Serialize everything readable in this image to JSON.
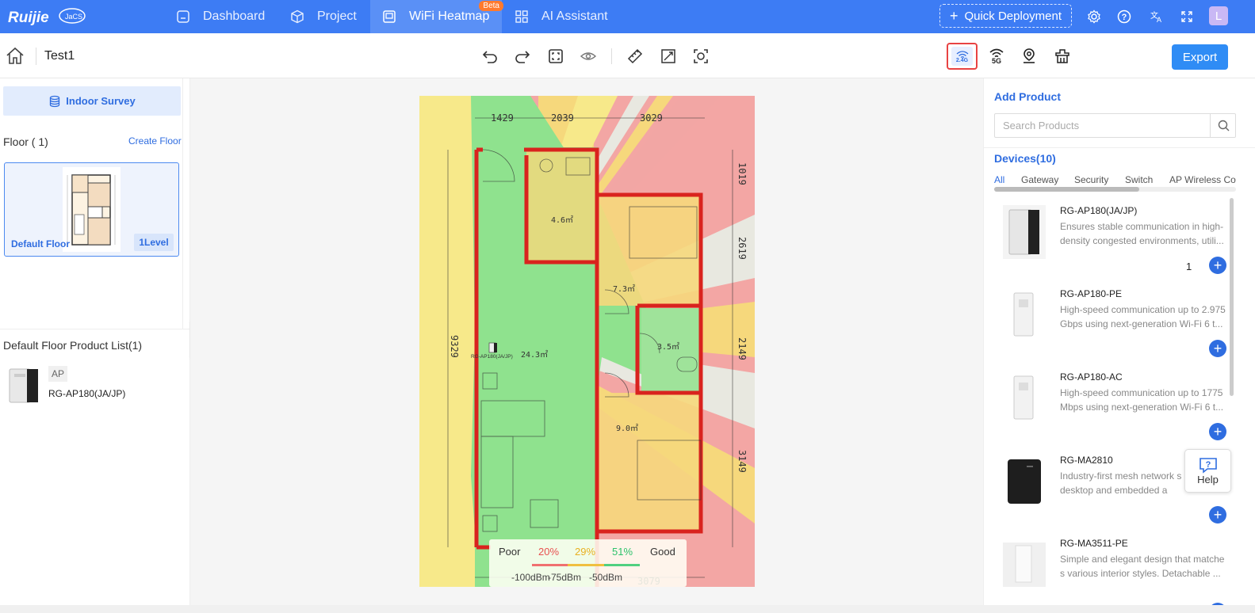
{
  "nav": {
    "logo_text": "Ruijie",
    "logo_sub": "JaCS",
    "items": [
      {
        "label": "Dashboard"
      },
      {
        "label": "Project"
      },
      {
        "label": "WiFi Heatmap",
        "badge": "Beta"
      },
      {
        "label": "AI Assistant"
      }
    ],
    "quick_deployment": "Quick Deployment",
    "avatar": "L"
  },
  "toolbar": {
    "project_name": "Test1",
    "band_24": "2.4G",
    "band_5": "5G",
    "export_label": "Export"
  },
  "left": {
    "indoor_survey": "Indoor Survey",
    "floor_title": "Floor ( 1)",
    "create_floor": "Create Floor",
    "floor_name": "Default Floor",
    "floor_level": "1Level",
    "product_list_title": "Default Floor Product List(1)",
    "product_type": "AP",
    "product_name": "RG-AP180(JA/JP)"
  },
  "canvas": {
    "dims_top": [
      "1429",
      "2039",
      "3029"
    ],
    "dims_right": [
      "1019",
      "2619",
      "2149",
      "3149"
    ],
    "dim_left": "9329",
    "dim_bottom": "3079",
    "rooms": [
      "4.6㎡",
      "7.3㎡",
      "24.3㎡",
      "3.5㎡",
      "9.0㎡"
    ],
    "ap_label": "RG-AP180(JA/JP)",
    "legend": {
      "poor": "Poor",
      "good": "Good",
      "p20": "20%",
      "p29": "29%",
      "p51": "51%",
      "r1": "-100dBm",
      "r2": "-75dBm",
      "r3": "-50dBm",
      "colors": [
        "#f07070",
        "#f0c040",
        "#50d080"
      ]
    }
  },
  "right": {
    "add_product": "Add Product",
    "search_placeholder": "Search Products",
    "devices_title": "Devices(10)",
    "tabs": [
      "All",
      "Gateway",
      "Security",
      "Switch",
      "AP Wireless Co"
    ],
    "devices": [
      {
        "name": "RG-AP180(JA/JP)",
        "desc": "Ensures stable communication in high-density congested environments, utili...",
        "qty": "1"
      },
      {
        "name": "RG-AP180-PE",
        "desc": "High-speed communication up to 2.975 Gbps using next-generation Wi-Fi 6 t...",
        "qty": ""
      },
      {
        "name": "RG-AP180-AC",
        "desc": "High-speed communication up to 1775 Mbps using next-generation Wi-Fi 6 t...",
        "qty": ""
      },
      {
        "name": "RG-MA2810",
        "desc": "Industry-first mesh network s both desktop and embedded a",
        "qty": ""
      },
      {
        "name": "RG-MA3511-PE",
        "desc": "Simple and elegant design that matche s various interior styles. Detachable ...",
        "qty": ""
      }
    ],
    "help": "Help"
  }
}
